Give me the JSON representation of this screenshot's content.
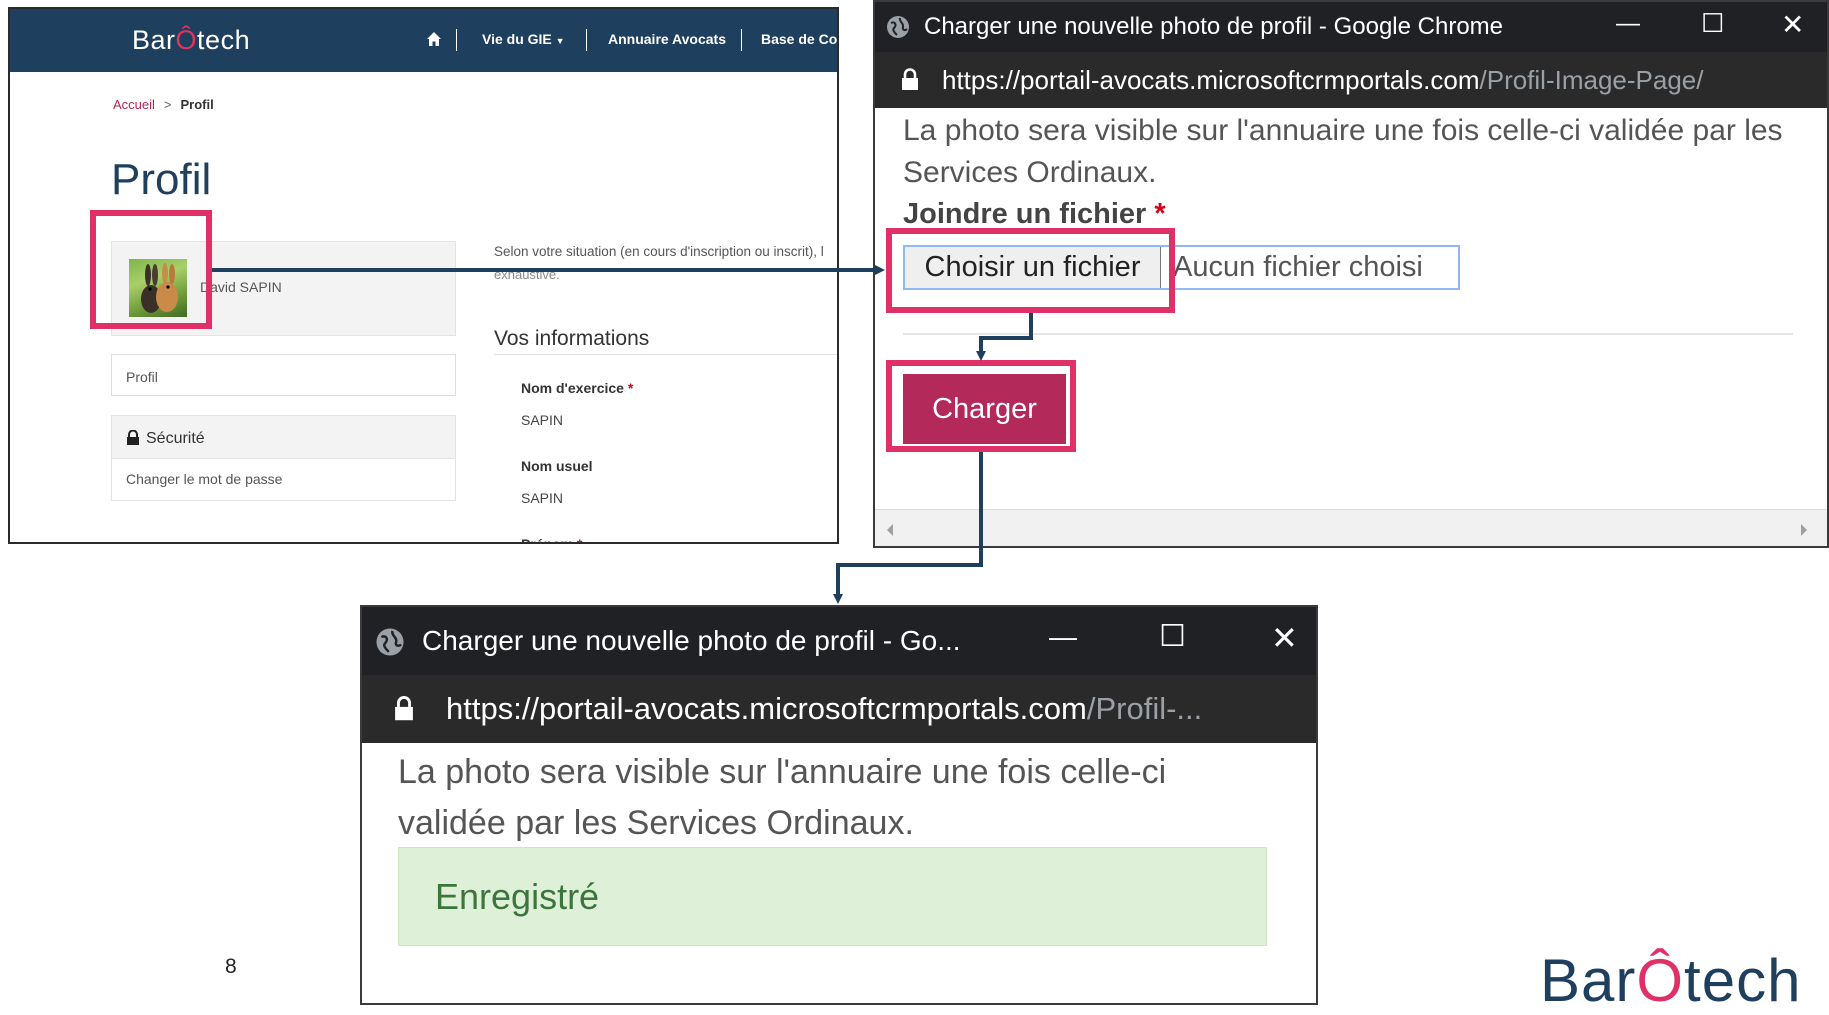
{
  "colors": {
    "brand_navy": "#1f3f5e",
    "brand_accent": "#e03068",
    "button_primary": "#b3295a",
    "success_bg": "#dff0d8",
    "success_text": "#3c763d",
    "chrome_dark": "#202124"
  },
  "portal": {
    "logo": {
      "part1": "Bar",
      "hat": "Ô",
      "part2": "tech"
    },
    "nav": {
      "home_icon": "home-icon",
      "vie_du_gie": "Vie du GIE",
      "dropdown_icon": "caret-down-icon",
      "annuaire": "Annuaire Avocats",
      "base": "Base de Con"
    },
    "breadcrumb": {
      "home": "Accueil",
      "separator": ">",
      "current": "Profil"
    },
    "page_title": "Profil",
    "profile_name": "David SAPIN",
    "sidebar": {
      "profil": "Profil",
      "security_icon": "lock-icon",
      "security": "Sécurité",
      "change_password": "Changer le mot de passe"
    },
    "situation_text": "Selon votre situation (en cours d'inscription ou inscrit), l",
    "situation_text_2": "exhaustive.",
    "section_title": "Vos informations",
    "fields": [
      {
        "label": "Nom d'exercice",
        "required": "*",
        "value": "SAPIN"
      },
      {
        "label": "Nom usuel",
        "required": "",
        "value": "SAPIN"
      },
      {
        "label": "Prénom",
        "required": "*",
        "value": ""
      }
    ]
  },
  "popup_upload": {
    "window_title": "Charger une nouvelle photo de profil - Google Chrome",
    "controls": {
      "minimize": "—",
      "maximize": "☐",
      "close": "✕"
    },
    "url_host": "https://portail-avocats.microsoftcrmportals.com",
    "url_path": "/Profil-Image-Page/",
    "note": "La photo sera visible sur l'annuaire une fois celle-ci validée par les Services Ordinaux.",
    "file_label": "Joindre un fichier",
    "file_required": "*",
    "choose_button": "Choisir un fichier",
    "no_file": "Aucun fichier choisi",
    "upload_button": "Charger"
  },
  "popup_success": {
    "window_title": "Charger une nouvelle photo de profil - Go...",
    "controls": {
      "minimize": "—",
      "maximize": "☐",
      "close": "✕"
    },
    "url_host": "https://portail-avocats.microsoftcrmportals.com",
    "url_path": "/Profil-...",
    "note_line1": "La photo sera visible sur l'annuaire une fois celle-ci",
    "note_line2": "validée par les Services Ordinaux.",
    "success_message": "Enregistré"
  },
  "slide": {
    "page_number": "8",
    "logo": {
      "part1": "Bar",
      "hat": "Ô",
      "part2": "tech"
    }
  }
}
